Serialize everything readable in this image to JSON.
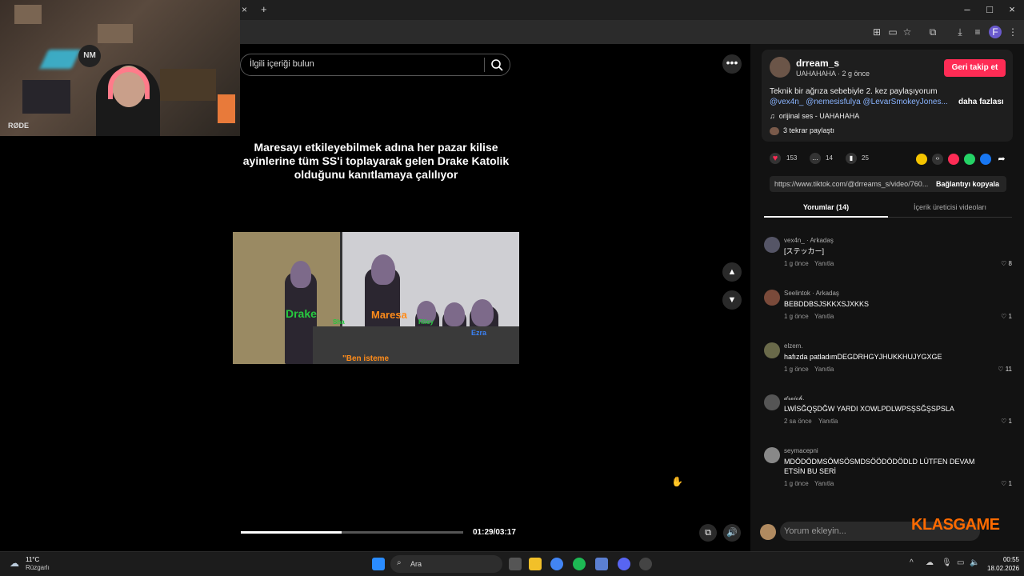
{
  "window_controls": {
    "close_tab": "×",
    "new_tab": "+",
    "minimize": "–",
    "maximize": "□",
    "close": "×"
  },
  "search": {
    "placeholder": "İlgili içeriği bulun"
  },
  "video": {
    "caption": "Maresayı etkileyebilmek adına her pazar kilise ayinlerine tüm SS'i toplayarak gelen Drake Katolik olduğunu kanıtlamaya çalılıyor",
    "labels": {
      "drake": "Drake",
      "s_label": "Sha",
      "maresa": "Maresa",
      "riley": "Riley",
      "ezra": "Ezra",
      "subtitle": "\"Ben isteme"
    },
    "progress": 0.454,
    "time": "01:29/03:17"
  },
  "post": {
    "username": "drream_s",
    "meta": "UAHAHAHA · 2 g önce",
    "follow_label": "Geri takip et",
    "description_text": "Teknik bir ağrıza sebebiyle 2. kez paylaşıyorum ",
    "mention1": "@vex4n_",
    "mention2": "@nemesisfulya",
    "mention3": "@LevarSmokeyJones...",
    "more_label": "daha fazlası",
    "sound": "orijinal ses - UAHAHAHA",
    "reposts": "3 tekrar paylaştı",
    "likes": "153",
    "comments": "14",
    "saves": "25",
    "link_url": "https://www.tiktok.com/@drreams_s/video/760...",
    "copy_label": "Bağlantıyı kopyala"
  },
  "tabs": {
    "comments": "Yorumlar (14)",
    "creator_videos": "İçerik üreticisi videoları"
  },
  "comments": [
    {
      "name": "vex4n_ · Arkadaş",
      "text": "[ステッカー]",
      "time": "1 g önce",
      "reply": "Yanıtla",
      "likes": "8"
    },
    {
      "name": "Seelintok · Arkadaş",
      "text": "BEBDDBSJSKKXSJXKKS",
      "time": "1 g önce",
      "reply": "Yanıtla",
      "likes": "1"
    },
    {
      "name": "elzem.",
      "text": "hafızda patladımDEGDRHGYJHUKKHUJYGXGE",
      "time": "1 g önce",
      "reply": "Yanıtla",
      "likes": "11"
    },
    {
      "name": "𝓭𝓻𝓮𝓲𝓬𝓱.",
      "text": "LWİSĞQŞDĞW YARDI XOWLPDLWPSŞSĞŞSPSLA",
      "time": "2 sa önce",
      "reply": "Yanıtla",
      "likes": "1"
    },
    {
      "name": "seymacepni",
      "text": "MDÖDÖDMSÖMSÖSMDSÖÖDÖDÖDLD LÜTFEN DEVAM ETSİN BU SERİ",
      "time": "1 g önce",
      "reply": "Yanıtla",
      "likes": "1"
    }
  ],
  "comment_input": {
    "placeholder": "Yorum ekleyin..."
  },
  "watermark": "KLASGAME",
  "webcam": {
    "logo": "NM",
    "mic": "RØDE"
  },
  "taskbar": {
    "temp": "11°C",
    "weather": "Rüzgarlı",
    "search": "Ara",
    "time": "00:55",
    "date": "18.02.2026"
  },
  "colors": {
    "accent": "#fe2c55",
    "mention": "#8ab4ff",
    "watermark": "#ff6a00"
  }
}
